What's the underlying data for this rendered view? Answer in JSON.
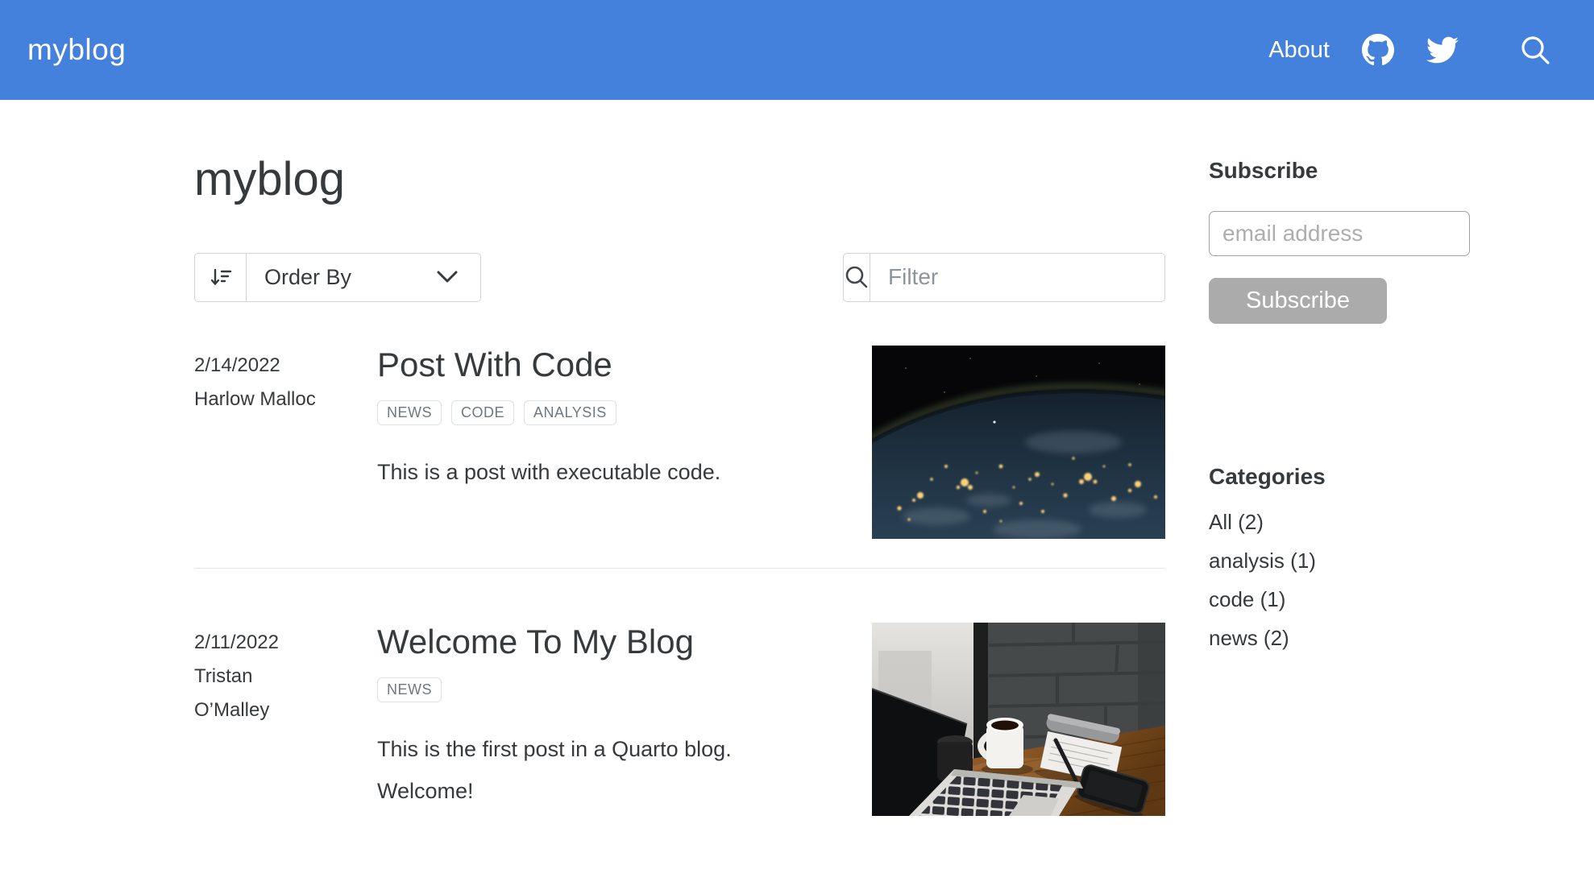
{
  "navbar": {
    "brand": "myblog",
    "about_label": "About",
    "icons": [
      "github-icon",
      "twitter-icon",
      "search-icon"
    ]
  },
  "page_title": "myblog",
  "toolbar": {
    "order_by_label": "Order By",
    "order_icon": "sort-amount-down-icon",
    "filter_placeholder": "Filter",
    "filter_icon": "search-icon"
  },
  "posts": [
    {
      "date": "2/14/2022",
      "author": "Harlow Malloc",
      "title": "Post With Code",
      "tags": [
        "NEWS",
        "CODE",
        "ANALYSIS"
      ],
      "description": "This is a post with executable code.",
      "image": "earth-at-night-from-space"
    },
    {
      "date": "2/11/2022",
      "author": "Tristan O’Malley",
      "title": "Welcome To My Blog",
      "tags": [
        "NEWS"
      ],
      "description": "This is the first post in a Quarto blog. Welcome!",
      "image": "desk-with-laptop-coffee-notepad-phone"
    }
  ],
  "sidebar": {
    "subscribe_heading": "Subscribe",
    "email_placeholder": "email address",
    "subscribe_button_label": "Subscribe",
    "categories_heading": "Categories",
    "categories": [
      "All (2)",
      "analysis (1)",
      "code (1)",
      "news (2)"
    ]
  },
  "colors": {
    "navbar_bg": "#4381dd",
    "text": "#373a3c",
    "muted": "#6f7780",
    "button_bg": "#ababab"
  }
}
